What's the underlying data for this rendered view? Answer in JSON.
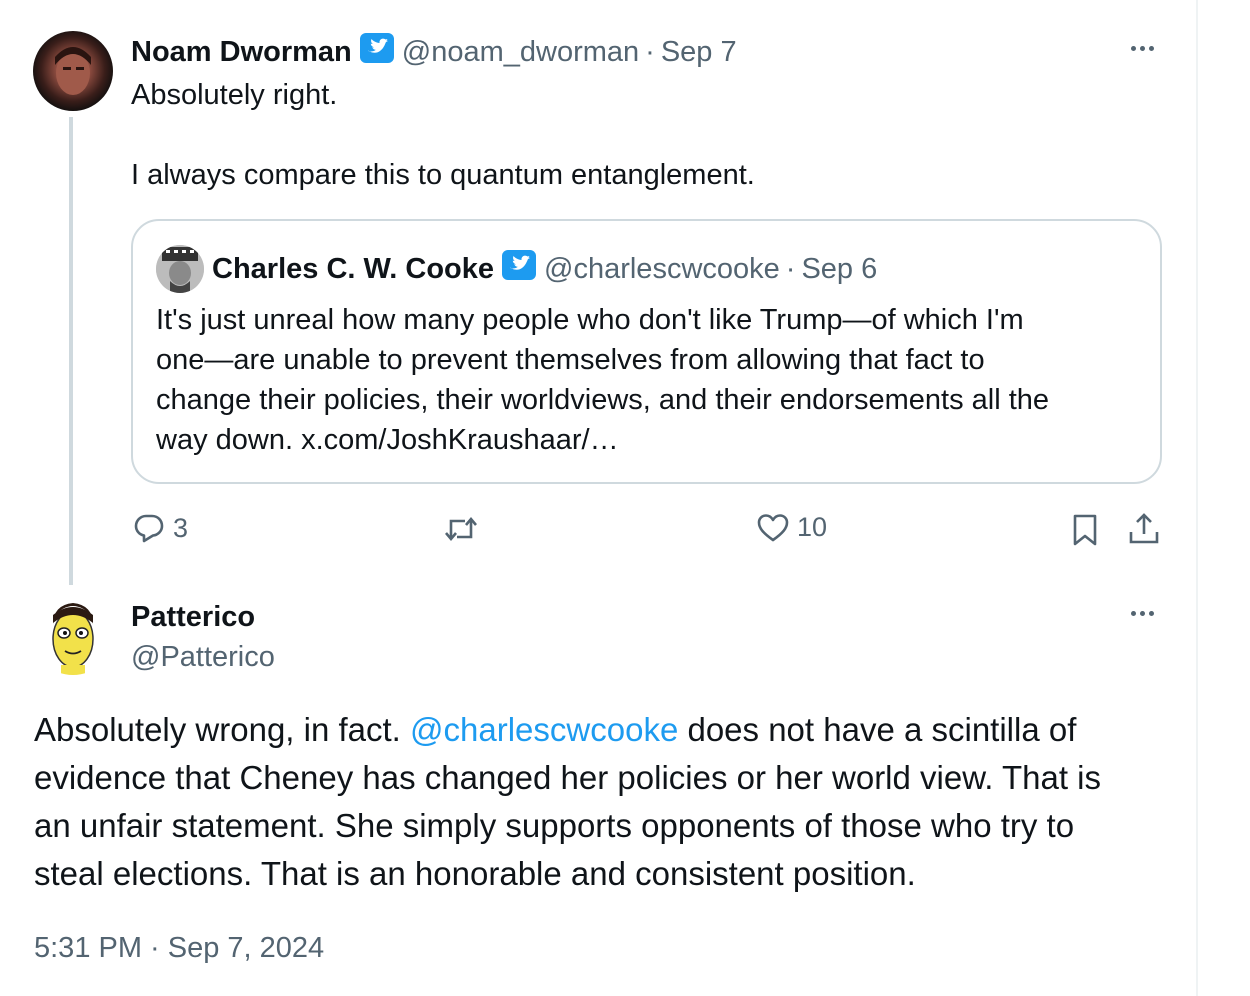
{
  "tweet1": {
    "author_name": "Noam Dworman",
    "handle": "@noam_dworman",
    "date": "Sep 7",
    "text_line1": "Absolutely right.",
    "text_line2": "I always compare this to quantum entanglement.",
    "actions": {
      "replies": "3",
      "likes": "10"
    }
  },
  "quote": {
    "author_name": "Charles C. W. Cooke",
    "handle": "@charlescwcooke",
    "date": "Sep 6",
    "lines": [
      "It's just unreal how many people who don't like Trump—of which I'm",
      "one—are unable to prevent themselves from allowing that fact to",
      "change their policies, their worldviews, and their endorsements all the",
      "way down. x.com/JoshKraushaar/…"
    ]
  },
  "tweet2": {
    "author_name": "Patterico",
    "handle": "@Patterico",
    "text": {
      "prefix": "Absolutely wrong, in fact. ",
      "mention": "@charlescwcooke",
      "line1_rest": " does not have a scintilla of",
      "line2": "evidence that Cheney has changed her policies or her world view. That is",
      "line3": "an unfair statement. She simply supports opponents of those who try to",
      "line4": "steal elections. That is an honorable and consistent position."
    },
    "timestamp": "5:31 PM · Sep 7, 2024"
  },
  "separator": "·",
  "colors": {
    "link": "#1d9bf0",
    "muted": "#536471",
    "text": "#0f1419",
    "border": "#cfd9de"
  },
  "icons": [
    "more-icon",
    "verified-badge-icon",
    "reply-icon",
    "retweet-icon",
    "like-icon",
    "bookmark-icon",
    "share-icon"
  ]
}
